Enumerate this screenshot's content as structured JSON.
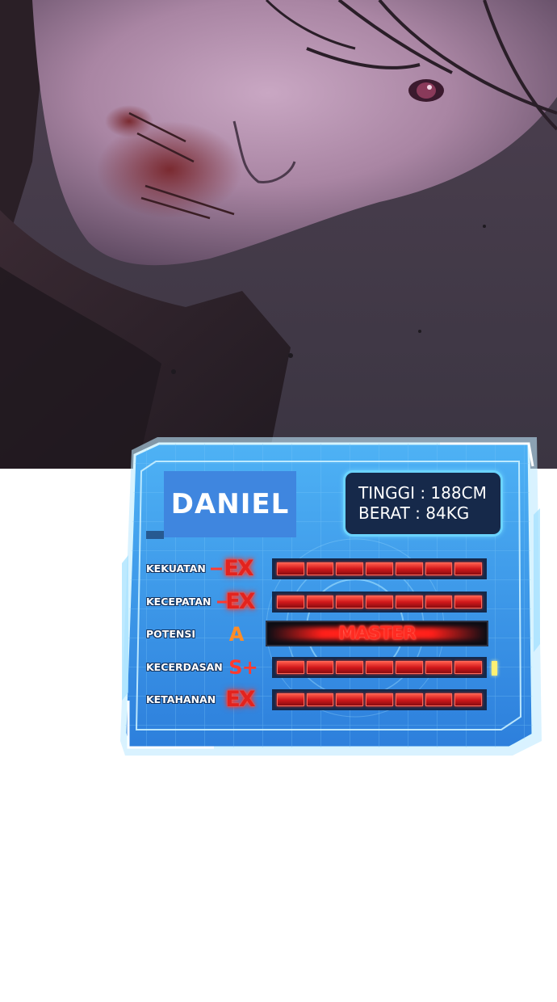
{
  "card": {
    "name": "DANIEL",
    "height_label": "TINGGI : 188CM",
    "weight_label": "BERAT : 84KG"
  },
  "attributes": [
    {
      "label": "KEKUATAN",
      "rank": "EX",
      "rank_style": "ex",
      "bar_value": "full"
    },
    {
      "label": "KECEPATAN",
      "rank": "EX",
      "rank_style": "ex",
      "bar_value": "full"
    },
    {
      "label": "POTENSI",
      "rank": "A",
      "rank_style": "a",
      "bar_value": "MASTER"
    },
    {
      "label": "KECERDASAN",
      "rank": "S+",
      "rank_style": "s",
      "bar_value": "full"
    },
    {
      "label": "KETAHANAN",
      "rank": "EX",
      "rank_style": "ex",
      "bar_value": "full"
    }
  ],
  "colors": {
    "window_blue": "#3fa3f0",
    "frame_light": "#9fe0ff",
    "rank_ex": "#e3231e",
    "rank_a": "#ff8c26",
    "rank_s": "#ff3b30",
    "bar_fill": "#d1181b"
  }
}
